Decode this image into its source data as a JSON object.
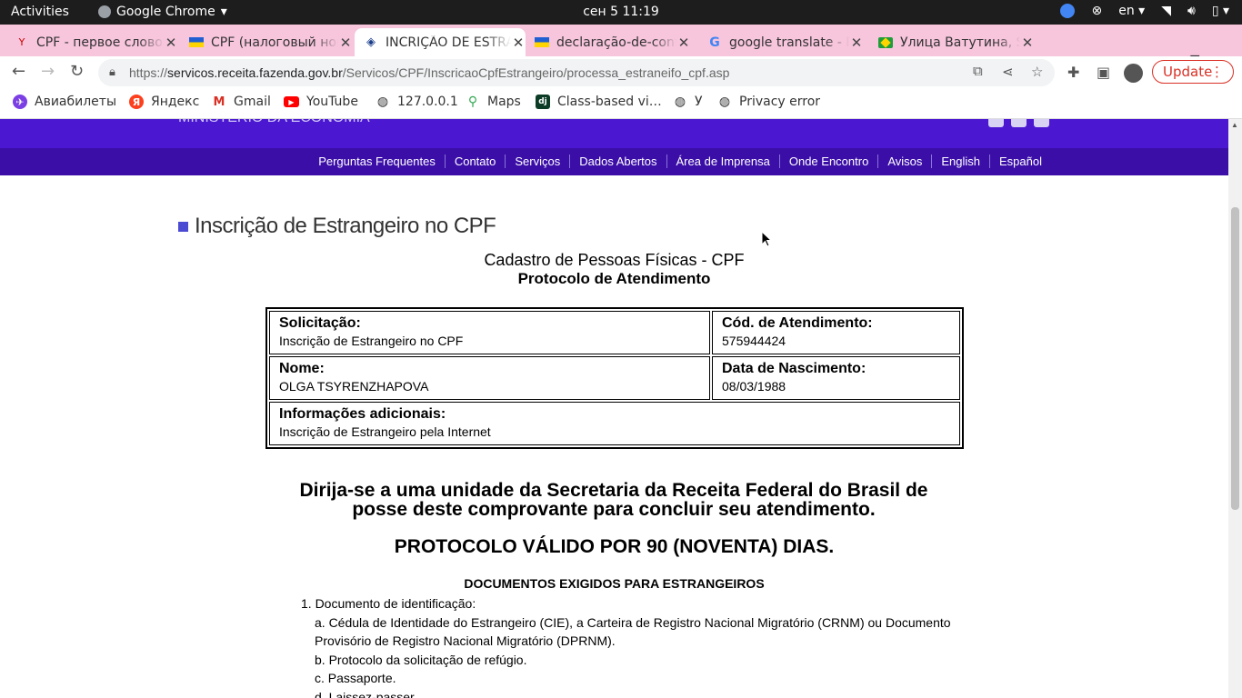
{
  "os": {
    "activities": "Activities",
    "app_name": "Google Chrome",
    "clock": "сен 5  11:19",
    "lang": "en"
  },
  "tabs": [
    {
      "title": "CPF - первое слово на…",
      "favicon": "yandex-q-icon"
    },
    {
      "title": "CPF (налоговый номер)",
      "favicon": "flag-icon"
    },
    {
      "title": "INCRIÇÃO DE ESTRANGEIRO",
      "favicon": "receita-icon",
      "active": true
    },
    {
      "title": "declaração-de-conformidade",
      "favicon": "flag-icon"
    },
    {
      "title": "google translate - Поиск",
      "favicon": "google-icon"
    },
    {
      "title": "Улица Ватутина, S",
      "favicon": "brazil-flag-icon"
    }
  ],
  "toolbar": {
    "url_prefix": "https://",
    "url_host": "servicos.receita.fazenda.gov.br",
    "url_path": "/Servicos/CPF/InscricaoCpfEstrangeiro/processa_estraneifo_cpf.asp",
    "update_label": "Update"
  },
  "bookmarks": [
    {
      "label": "Авиабилеты",
      "icon": "aviasales-icon"
    },
    {
      "label": "Яндекс",
      "icon": "yandex-icon"
    },
    {
      "label": "Gmail",
      "icon": "gmail-icon"
    },
    {
      "label": "YouTube",
      "icon": "youtube-icon"
    },
    {
      "label": "127.0.0.1",
      "icon": "globe-icon"
    },
    {
      "label": "Maps",
      "icon": "maps-icon"
    },
    {
      "label": "Class-based vi…",
      "icon": "django-icon"
    },
    {
      "label": "У",
      "icon": "globe-icon"
    },
    {
      "label": "Privacy error",
      "icon": "globe-icon"
    }
  ],
  "site": {
    "ministry": "MINISTÉRIO DA ECONOMIA",
    "menu": [
      "Perguntas Frequentes",
      "Contato",
      "Serviços",
      "Dados Abertos",
      "Área de Imprensa",
      "Onde Encontro",
      "Avisos",
      "English",
      "Español"
    ]
  },
  "content": {
    "page_title": "Inscrição de Estrangeiro no CPF",
    "subtitle": "Cadastro de Pessoas Físicas - CPF",
    "subtitle2": "Protocolo de Atendimento",
    "solicitacao_label": "Solicitação:",
    "solicitacao_value": "Inscrição de Estrangeiro no CPF",
    "cod_label": "Cód. de Atendimento:",
    "cod_value": "575944424",
    "nome_label": "Nome:",
    "nome_value": "OLGA TSYRENZHAPOVA",
    "nasc_label": "Data de Nascimento:",
    "nasc_value": "08/03/1988",
    "info_label": "Informações adicionais:",
    "info_value": "Inscrição de Estrangeiro pela Internet",
    "notice1": "Dirija-se a uma unidade da Secretaria da Receita Federal do Brasil de posse deste comprovante para concluir seu atendimento.",
    "notice2": "PROTOCOLO VÁLIDO POR 90 (NOVENTA) DIAS.",
    "docs_title": "DOCUMENTOS EXIGIDOS PARA ESTRANGEIROS",
    "list": [
      "1. Documento de identificação:",
      "a. Cédula de Identidade do Estrangeiro (CIE), a Carteira de Registro Nacional Migratório (CRNM) ou Documento Provisório de Registro Nacional Migratório (DPRNM).",
      "b. Protocolo da solicitação de refúgio.",
      "c. Passaporte.",
      "d. Laissez-passer."
    ]
  }
}
